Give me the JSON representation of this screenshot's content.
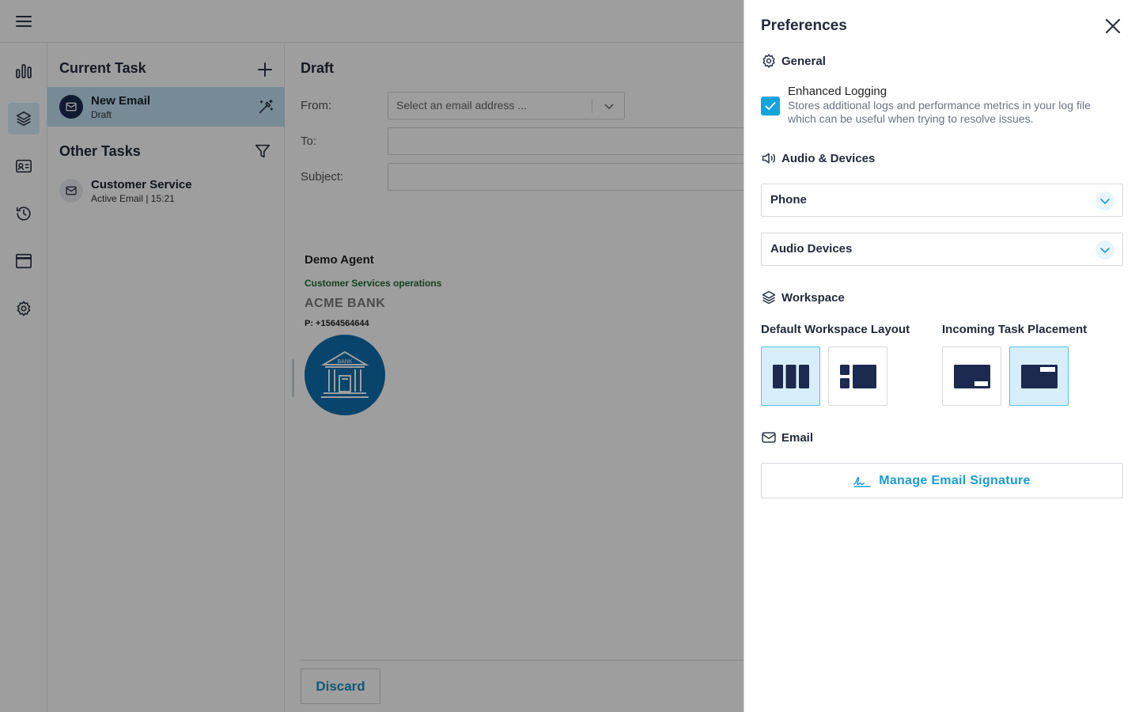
{
  "task_panel": {
    "current_title": "Current Task",
    "current_task": {
      "name": "New Email",
      "status": "Draft"
    },
    "other_title": "Other Tasks",
    "other_task": {
      "name": "Customer Service",
      "status": "Active Email | 15:21"
    }
  },
  "compose": {
    "title": "Draft",
    "from_label": "From:",
    "from_placeholder": "Select an email address ...",
    "to_label": "To:",
    "subject_label": "Subject:",
    "discard_label": "Discard",
    "signature": {
      "name": "Demo Agent",
      "department": "Customer Services operations",
      "company": "ACME BANK",
      "phone": "P: +1564564644",
      "logo_text": "BANK"
    }
  },
  "preferences": {
    "title": "Preferences",
    "general": {
      "heading": "General",
      "enhanced_logging": {
        "label": "Enhanced Logging",
        "description": "Stores additional logs and performance metrics in your log file which can be useful when trying to resolve issues.",
        "checked": true
      }
    },
    "audio": {
      "heading": "Audio & Devices",
      "phone_label": "Phone",
      "devices_label": "Audio Devices"
    },
    "workspace": {
      "heading": "Workspace",
      "default_layout_label": "Default Workspace Layout",
      "incoming_placement_label": "Incoming Task Placement",
      "selected_layout": "three-column",
      "selected_placement": "top-right"
    },
    "email": {
      "heading": "Email",
      "manage_signature_label": "Manage Email Signature"
    }
  },
  "colors": {
    "accent": "#14a4dc",
    "navy": "#1b2a4e",
    "selected_bg": "#d7eefa",
    "signature_green": "#1f6b2d",
    "bank_blue": "#0e6fae"
  }
}
